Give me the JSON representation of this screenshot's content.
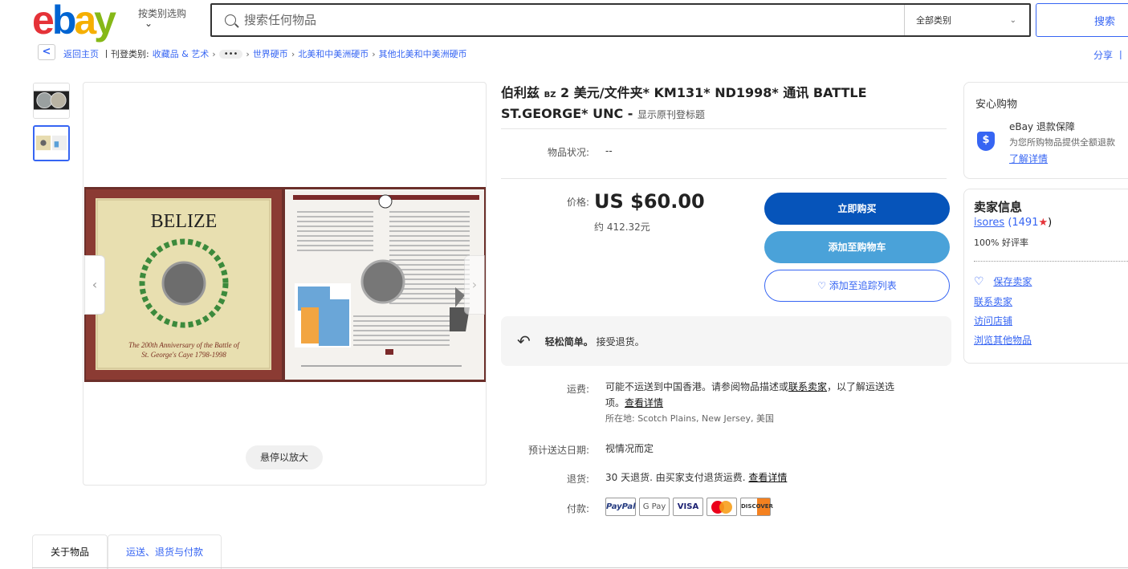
{
  "header": {
    "logo_letters": [
      "e",
      "b",
      "a",
      "y"
    ],
    "shop_by_category": "按类别选购",
    "search_placeholder": "搜索任何物品",
    "category_select": "全部类别",
    "search_button": "搜索"
  },
  "breadcrumb": {
    "back_home": "返回主页",
    "listed_in": "丨刊登类别:",
    "items": [
      "收藏品 & 艺术",
      "世界硬币",
      "北美和中美洲硬币",
      "其他北美和中美洲硬币"
    ],
    "more": "•••",
    "share": "分享 丨"
  },
  "gallery": {
    "zoom_hint": "悬停以放大",
    "image_text": {
      "belize": "BELIZE",
      "caption_line1": "The 200th Anniversary of the Battle of",
      "caption_line2": "St. George's Caye 1798-1998"
    }
  },
  "listing": {
    "title_part1": "伯利兹",
    "title_small": "BZ",
    "title_part2": "2 美元/文件夹* KM131* ND1998* 通讯 BATTLE ST.GEORGE* UNC -",
    "title_original": "显示原刊登标题",
    "condition_label": "物品状况:",
    "condition_value": "--",
    "price_label": "价格:",
    "price": "US $60.00",
    "price_approx": "约 412.32元",
    "buy_now": "立即购买",
    "add_to_cart": "添加至购物车",
    "add_to_watchlist": "♡ 添加至追踪列表",
    "returns_box": {
      "bold": "轻松简单。",
      "text": "接受退货。"
    },
    "shipping_label": "运费:",
    "shipping_text1": "可能不运送到中国香港。请参阅物品描述或",
    "shipping_link": "联系卖家",
    "shipping_text2": "，以了解运送选",
    "shipping_text3": "项。",
    "shipping_details": "查看详情",
    "location": "所在地: Scotch Plains, New Jersey, 美国",
    "delivery_label": "预计送达日期:",
    "delivery_value": "视情况而定",
    "returns_label": "退货:",
    "returns_value": "30 天退货. 由买家支付退货运费.",
    "returns_details": "查看详情",
    "payments_label": "付款:",
    "payments": [
      "PayPal",
      "G Pay",
      "VISA",
      "",
      "DISCOVER"
    ]
  },
  "safe_buy": {
    "title": "安心购物",
    "guarantee": "eBay 退款保障",
    "desc": "为您所购物品提供全额退款",
    "learn_more": "了解详情"
  },
  "seller": {
    "title": "卖家信息",
    "name": "isores",
    "feedback": "(1491",
    "feedback_end": ")",
    "positive": "100% 好评率",
    "save_seller": "保存卖家",
    "contact": "联系卖家",
    "visit_store": "访问店铺",
    "other_items": "浏览其他物品"
  },
  "tabs": [
    "关于物品",
    "运送、退货与付款"
  ],
  "colors": {
    "accent": "#3665f3",
    "buy": "#0654ba",
    "cart": "#4aa2d9"
  }
}
